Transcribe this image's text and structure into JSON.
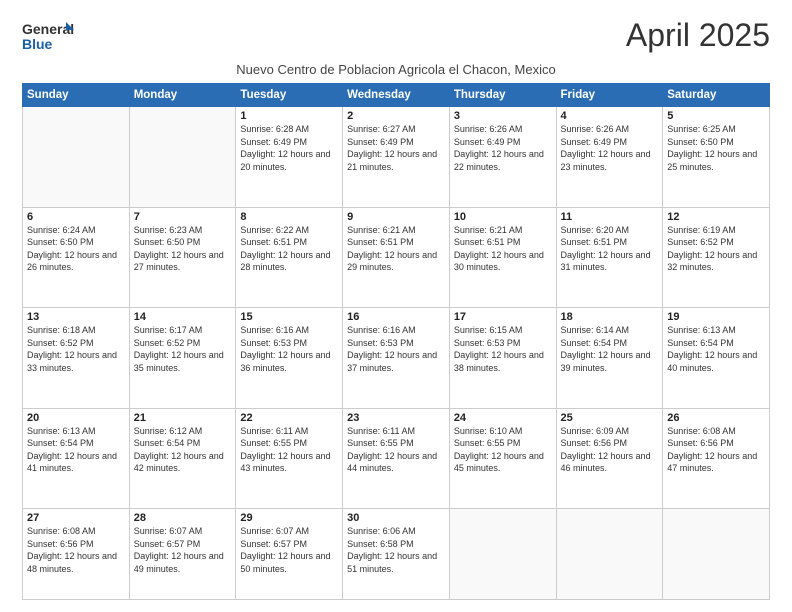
{
  "logo": {
    "line1": "General",
    "line2": "Blue"
  },
  "title": "April 2025",
  "subtitle": "Nuevo Centro de Poblacion Agricola el Chacon, Mexico",
  "days_header": [
    "Sunday",
    "Monday",
    "Tuesday",
    "Wednesday",
    "Thursday",
    "Friday",
    "Saturday"
  ],
  "weeks": [
    [
      {
        "day": "",
        "info": ""
      },
      {
        "day": "",
        "info": ""
      },
      {
        "day": "1",
        "info": "Sunrise: 6:28 AM\nSunset: 6:49 PM\nDaylight: 12 hours and 20 minutes."
      },
      {
        "day": "2",
        "info": "Sunrise: 6:27 AM\nSunset: 6:49 PM\nDaylight: 12 hours and 21 minutes."
      },
      {
        "day": "3",
        "info": "Sunrise: 6:26 AM\nSunset: 6:49 PM\nDaylight: 12 hours and 22 minutes."
      },
      {
        "day": "4",
        "info": "Sunrise: 6:26 AM\nSunset: 6:49 PM\nDaylight: 12 hours and 23 minutes."
      },
      {
        "day": "5",
        "info": "Sunrise: 6:25 AM\nSunset: 6:50 PM\nDaylight: 12 hours and 25 minutes."
      }
    ],
    [
      {
        "day": "6",
        "info": "Sunrise: 6:24 AM\nSunset: 6:50 PM\nDaylight: 12 hours and 26 minutes."
      },
      {
        "day": "7",
        "info": "Sunrise: 6:23 AM\nSunset: 6:50 PM\nDaylight: 12 hours and 27 minutes."
      },
      {
        "day": "8",
        "info": "Sunrise: 6:22 AM\nSunset: 6:51 PM\nDaylight: 12 hours and 28 minutes."
      },
      {
        "day": "9",
        "info": "Sunrise: 6:21 AM\nSunset: 6:51 PM\nDaylight: 12 hours and 29 minutes."
      },
      {
        "day": "10",
        "info": "Sunrise: 6:21 AM\nSunset: 6:51 PM\nDaylight: 12 hours and 30 minutes."
      },
      {
        "day": "11",
        "info": "Sunrise: 6:20 AM\nSunset: 6:51 PM\nDaylight: 12 hours and 31 minutes."
      },
      {
        "day": "12",
        "info": "Sunrise: 6:19 AM\nSunset: 6:52 PM\nDaylight: 12 hours and 32 minutes."
      }
    ],
    [
      {
        "day": "13",
        "info": "Sunrise: 6:18 AM\nSunset: 6:52 PM\nDaylight: 12 hours and 33 minutes."
      },
      {
        "day": "14",
        "info": "Sunrise: 6:17 AM\nSunset: 6:52 PM\nDaylight: 12 hours and 35 minutes."
      },
      {
        "day": "15",
        "info": "Sunrise: 6:16 AM\nSunset: 6:53 PM\nDaylight: 12 hours and 36 minutes."
      },
      {
        "day": "16",
        "info": "Sunrise: 6:16 AM\nSunset: 6:53 PM\nDaylight: 12 hours and 37 minutes."
      },
      {
        "day": "17",
        "info": "Sunrise: 6:15 AM\nSunset: 6:53 PM\nDaylight: 12 hours and 38 minutes."
      },
      {
        "day": "18",
        "info": "Sunrise: 6:14 AM\nSunset: 6:54 PM\nDaylight: 12 hours and 39 minutes."
      },
      {
        "day": "19",
        "info": "Sunrise: 6:13 AM\nSunset: 6:54 PM\nDaylight: 12 hours and 40 minutes."
      }
    ],
    [
      {
        "day": "20",
        "info": "Sunrise: 6:13 AM\nSunset: 6:54 PM\nDaylight: 12 hours and 41 minutes."
      },
      {
        "day": "21",
        "info": "Sunrise: 6:12 AM\nSunset: 6:54 PM\nDaylight: 12 hours and 42 minutes."
      },
      {
        "day": "22",
        "info": "Sunrise: 6:11 AM\nSunset: 6:55 PM\nDaylight: 12 hours and 43 minutes."
      },
      {
        "day": "23",
        "info": "Sunrise: 6:11 AM\nSunset: 6:55 PM\nDaylight: 12 hours and 44 minutes."
      },
      {
        "day": "24",
        "info": "Sunrise: 6:10 AM\nSunset: 6:55 PM\nDaylight: 12 hours and 45 minutes."
      },
      {
        "day": "25",
        "info": "Sunrise: 6:09 AM\nSunset: 6:56 PM\nDaylight: 12 hours and 46 minutes."
      },
      {
        "day": "26",
        "info": "Sunrise: 6:08 AM\nSunset: 6:56 PM\nDaylight: 12 hours and 47 minutes."
      }
    ],
    [
      {
        "day": "27",
        "info": "Sunrise: 6:08 AM\nSunset: 6:56 PM\nDaylight: 12 hours and 48 minutes."
      },
      {
        "day": "28",
        "info": "Sunrise: 6:07 AM\nSunset: 6:57 PM\nDaylight: 12 hours and 49 minutes."
      },
      {
        "day": "29",
        "info": "Sunrise: 6:07 AM\nSunset: 6:57 PM\nDaylight: 12 hours and 50 minutes."
      },
      {
        "day": "30",
        "info": "Sunrise: 6:06 AM\nSunset: 6:58 PM\nDaylight: 12 hours and 51 minutes."
      },
      {
        "day": "",
        "info": ""
      },
      {
        "day": "",
        "info": ""
      },
      {
        "day": "",
        "info": ""
      }
    ]
  ]
}
